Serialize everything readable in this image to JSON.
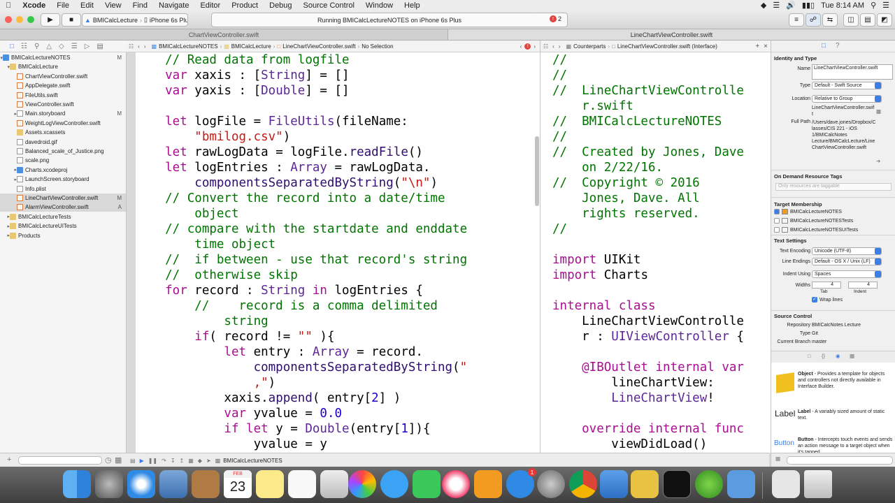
{
  "menubar": {
    "app": "Xcode",
    "items": [
      "File",
      "Edit",
      "View",
      "Find",
      "Navigate",
      "Editor",
      "Product",
      "Debug",
      "Source Control",
      "Window",
      "Help"
    ],
    "clock": "Tue 8:14 AM"
  },
  "toolbar": {
    "scheme": "BMICalcLecture",
    "device": "iPhone 6s Plus",
    "activity": "Running BMICalcLectureNOTES on iPhone 6s Plus",
    "error_count": "2"
  },
  "tabs": [
    "ChartViewController.swift",
    "LineChartViewController.swift"
  ],
  "navigator": {
    "items": [
      {
        "label": "BMICalcLectureNOTES",
        "icon": "project-icon",
        "indent": 0,
        "status": "M",
        "disclosure": "open"
      },
      {
        "label": "BMICalcLecture",
        "icon": "folder-icon",
        "indent": 1,
        "status": "",
        "disclosure": "open"
      },
      {
        "label": "ChartViewController.swift",
        "icon": "swift-file-icon",
        "indent": 2,
        "status": ""
      },
      {
        "label": "AppDelegate.swift",
        "icon": "swift-file-icon",
        "indent": 2,
        "status": ""
      },
      {
        "label": "FileUtils.swift",
        "icon": "swift-file-icon",
        "indent": 2,
        "status": ""
      },
      {
        "label": "ViewController.swift",
        "icon": "swift-file-icon",
        "indent": 2,
        "status": ""
      },
      {
        "label": "Main.storyboard",
        "icon": "storyboard-icon",
        "indent": 2,
        "status": "M",
        "disclosure": "closed"
      },
      {
        "label": "WeightLogViewController.swift",
        "icon": "swift-file-icon",
        "indent": 2,
        "status": ""
      },
      {
        "label": "Assets.xcassets",
        "icon": "folder-icon",
        "indent": 2,
        "status": ""
      },
      {
        "label": "davedroid.gif",
        "icon": "file-icon",
        "indent": 2,
        "status": ""
      },
      {
        "label": "Balanced_scale_of_Justice.png",
        "icon": "file-icon",
        "indent": 2,
        "status": ""
      },
      {
        "label": "scale.png",
        "icon": "file-icon",
        "indent": 2,
        "status": ""
      },
      {
        "label": "Charts.xcodeproj",
        "icon": "project-icon",
        "indent": 2,
        "status": "",
        "disclosure": "closed"
      },
      {
        "label": "LaunchScreen.storyboard",
        "icon": "storyboard-icon",
        "indent": 2,
        "status": "",
        "disclosure": "closed"
      },
      {
        "label": "Info.plist",
        "icon": "file-icon",
        "indent": 2,
        "status": ""
      },
      {
        "label": "LineChartViewController.swift",
        "icon": "swift-file-icon",
        "indent": 2,
        "status": "M",
        "selected": true
      },
      {
        "label": "AlarmViewController.swift",
        "icon": "swift-file-icon",
        "indent": 2,
        "status": "A",
        "selected": true
      },
      {
        "label": "BMICalcLectureTests",
        "icon": "folder-icon",
        "indent": 1,
        "status": "",
        "disclosure": "closed"
      },
      {
        "label": "BMICalcLectureUITests",
        "icon": "folder-icon",
        "indent": 1,
        "status": "",
        "disclosure": "closed"
      },
      {
        "label": "Products",
        "icon": "folder-icon",
        "indent": 1,
        "status": "",
        "disclosure": "closed"
      }
    ]
  },
  "left_jumpbar": [
    "BMICalcLectureNOTES",
    "BMICalcLecture",
    "LineChartViewController.swift",
    "No Selection"
  ],
  "right_jumpbar": [
    "Counterparts",
    "LineChartViewController.swift (Interface)"
  ],
  "left_code": [
    [
      [
        "cm",
        "    // Read data from logfile"
      ]
    ],
    [
      [
        "kw",
        "    var "
      ],
      [
        "pl",
        "xaxis : ["
      ],
      [
        "ty",
        "String"
      ],
      [
        "pl",
        "] = []"
      ]
    ],
    [
      [
        "kw",
        "    var "
      ],
      [
        "pl",
        "yaxis : ["
      ],
      [
        "ty",
        "Double"
      ],
      [
        "pl",
        "] = []"
      ]
    ],
    [
      [
        "pl",
        ""
      ]
    ],
    [
      [
        "kw",
        "    let "
      ],
      [
        "pl",
        "logFile = "
      ],
      [
        "ty",
        "FileUtils"
      ],
      [
        "pl",
        "(fileName:"
      ]
    ],
    [
      [
        "st",
        "        \"bmilog.csv\""
      ],
      [
        "pl",
        ")"
      ]
    ],
    [
      [
        "kw",
        "    let "
      ],
      [
        "pl",
        "rawLogData = logFile."
      ],
      [
        "fn",
        "readFile"
      ],
      [
        "pl",
        "()"
      ]
    ],
    [
      [
        "kw",
        "    let "
      ],
      [
        "pl",
        "logEntries : "
      ],
      [
        "ty",
        "Array"
      ],
      [
        "pl",
        " = rawLogData."
      ]
    ],
    [
      [
        "fn",
        "        componentsSeparatedByString"
      ],
      [
        "pl",
        "("
      ],
      [
        "st",
        "\"\\n\""
      ],
      [
        "pl",
        ")"
      ]
    ],
    [
      [
        "cm",
        "    // Convert the record into a date/time"
      ]
    ],
    [
      [
        "cm",
        "        object"
      ]
    ],
    [
      [
        "cm",
        "    // compare with the startdate and enddate"
      ]
    ],
    [
      [
        "cm",
        "        time object"
      ]
    ],
    [
      [
        "cm",
        "    //  if between - use that record's string"
      ]
    ],
    [
      [
        "cm",
        "    //  otherwise skip"
      ]
    ],
    [
      [
        "kw",
        "    for "
      ],
      [
        "pl",
        "record : "
      ],
      [
        "ty",
        "String"
      ],
      [
        "kw",
        " in "
      ],
      [
        "pl",
        "logEntries {"
      ]
    ],
    [
      [
        "cm",
        "        //    record is a comma delimited"
      ]
    ],
    [
      [
        "cm",
        "            string"
      ]
    ],
    [
      [
        "kw",
        "        if"
      ],
      [
        "pl",
        "( record != "
      ],
      [
        "st",
        "\"\""
      ],
      [
        "pl",
        " ){"
      ]
    ],
    [
      [
        "kw",
        "            let "
      ],
      [
        "pl",
        "entry : "
      ],
      [
        "ty",
        "Array"
      ],
      [
        "pl",
        " = record."
      ]
    ],
    [
      [
        "fn",
        "                componentsSeparatedByString"
      ],
      [
        "pl",
        "("
      ],
      [
        "st",
        "\""
      ]
    ],
    [
      [
        "st",
        "                ,\""
      ],
      [
        "pl",
        ")"
      ]
    ],
    [
      [
        "pl",
        "            xaxis."
      ],
      [
        "fn",
        "append"
      ],
      [
        "pl",
        "( entry["
      ],
      [
        "nm",
        "2"
      ],
      [
        "pl",
        "] )"
      ]
    ],
    [
      [
        "kw",
        "            var "
      ],
      [
        "pl",
        "yvalue = "
      ],
      [
        "nm",
        "0.0"
      ]
    ],
    [
      [
        "kw",
        "            if let "
      ],
      [
        "pl",
        "y = "
      ],
      [
        "ty",
        "Double"
      ],
      [
        "pl",
        "(entry["
      ],
      [
        "nm",
        "1"
      ],
      [
        "pl",
        "]){"
      ]
    ],
    [
      [
        "pl",
        "                yvalue = y"
      ]
    ]
  ],
  "right_code": [
    [
      [
        "cm",
        "//"
      ]
    ],
    [
      [
        "cm",
        "//"
      ]
    ],
    [
      [
        "cm",
        "//  LineChartViewControlle"
      ]
    ],
    [
      [
        "cm",
        "    r.swift"
      ]
    ],
    [
      [
        "cm",
        "//  BMICalcLectureNOTES"
      ]
    ],
    [
      [
        "cm",
        "//"
      ]
    ],
    [
      [
        "cm",
        "//  Created by Jones, Dave"
      ]
    ],
    [
      [
        "cm",
        "    on 2/22/16."
      ]
    ],
    [
      [
        "cm",
        "//  Copyright © 2016"
      ]
    ],
    [
      [
        "cm",
        "    Jones, Dave. All"
      ]
    ],
    [
      [
        "cm",
        "    rights reserved."
      ]
    ],
    [
      [
        "cm",
        "//"
      ]
    ],
    [
      [
        "pl",
        ""
      ]
    ],
    [
      [
        "kw",
        "import "
      ],
      [
        "pl",
        "UIKit"
      ]
    ],
    [
      [
        "kw",
        "import "
      ],
      [
        "pl",
        "Charts"
      ]
    ],
    [
      [
        "pl",
        ""
      ]
    ],
    [
      [
        "kw",
        "internal class"
      ]
    ],
    [
      [
        "pl",
        "    LineChartViewControlle"
      ]
    ],
    [
      [
        "pl",
        "    r : "
      ],
      [
        "ty",
        "UIViewController"
      ],
      [
        "pl",
        " {"
      ]
    ],
    [
      [
        "pl",
        ""
      ]
    ],
    [
      [
        "kw",
        "    @IBOutlet internal var"
      ]
    ],
    [
      [
        "pl",
        "        lineChartView:"
      ]
    ],
    [
      [
        "ty",
        "        LineChartView"
      ],
      [
        "pl",
        "!"
      ]
    ],
    [
      [
        "pl",
        ""
      ]
    ],
    [
      [
        "kw",
        "    override internal func"
      ]
    ],
    [
      [
        "pl",
        "        viewDidLoad()"
      ]
    ]
  ],
  "inspector": {
    "identity_title": "Identity and Type",
    "name_label": "Name",
    "name_value": "LineChartViewController.swift",
    "type_label": "Type",
    "type_value": "Default - Swift Source",
    "location_label": "Location",
    "location_value": "Relative to Group",
    "location_file": "LineChartViewController.swift",
    "fullpath_label": "Full Path",
    "fullpath_value": "/Users/dave.jones/Dropbox/Classes/CIS 221 - iOS 1/BMICalcNotes Lecture/BMICalcLecture/LineChartViewController.swift",
    "tags_title": "On Demand Resource Tags",
    "tags_placeholder": "Only resources are taggable",
    "target_title": "Target Membership",
    "targets": [
      {
        "label": "BMICalcLectureNOTES",
        "checked": true
      },
      {
        "label": "BMICalcLectureNOTESTests",
        "checked": false
      },
      {
        "label": "BMICalcLectureNOTESUITests",
        "checked": false
      }
    ],
    "text_title": "Text Settings",
    "encoding_label": "Text Encoding",
    "encoding_value": "Unicode (UTF-8)",
    "endings_label": "Line Endings",
    "endings_value": "Default - OS X / Unix (LF)",
    "indent_label": "Indent Using",
    "indent_value": "Spaces",
    "widths_label": "Widths",
    "tab_width": "4",
    "indent_width": "4",
    "tab_label": "Tab",
    "indent_sub_label": "Indent",
    "wrap_label": "Wrap lines",
    "source_title": "Source Control",
    "repo_label": "Repository",
    "repo_value": "BMICalcNotes Lecture",
    "sc_type_label": "Type",
    "sc_type_value": "Git",
    "branch_label": "Current Branch",
    "branch_value": "master",
    "library": [
      {
        "title": "Object",
        "desc": " - Provides a template for objects and controllers not directly available in Interface Builder."
      },
      {
        "title": "Label",
        "desc": " - A variably sized amount of static text."
      },
      {
        "title": "Button",
        "desc": " - Intercepts touch events and sends an action message to a target object when it's tapped."
      }
    ],
    "library_icon_label": "Label",
    "library_button_label": "Button"
  },
  "bottombar": {
    "target": "BMICalcLectureNOTES"
  },
  "dock": {
    "calendar_month": "FEB",
    "calendar_day": "23",
    "appstore_badge": "1"
  }
}
